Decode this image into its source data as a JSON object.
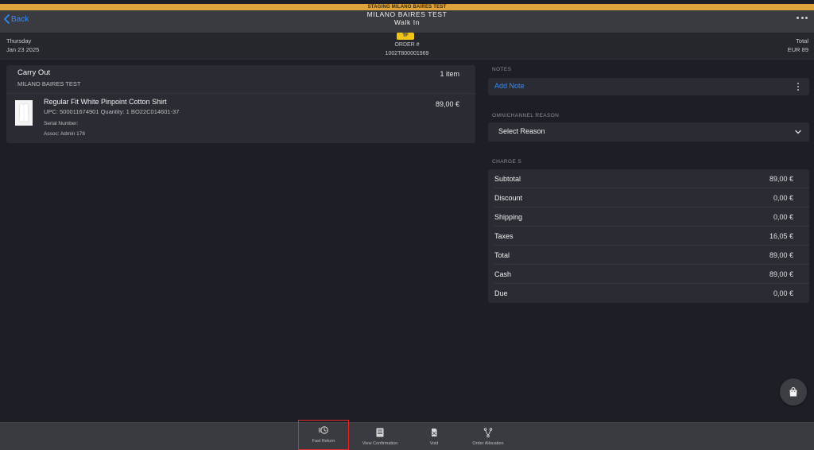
{
  "staging_banner": "STAGING MILANO BAIRES TEST",
  "header": {
    "back_label": "Back",
    "title": "MILANO BAIRES TEST",
    "subtitle": "Walk In"
  },
  "info": {
    "day": "Thursday",
    "date": "Jan 23 2025",
    "badge": "TF",
    "order_label": "ORDER #",
    "order_number": "1002T800001969",
    "total_label": "Total",
    "total_value": "EUR 89"
  },
  "order_card": {
    "fulfillment": "Carry Out",
    "store": "MILANO BAIRES TEST",
    "item_count": "1 item",
    "product": {
      "name": "Regular Fit White Pinpoint Cotton Shirt",
      "details": "UPC: 500011674901 Quantity: 1 BO22C014601-37",
      "serial": "Serial Number:",
      "assoc": "Assoc: Admin 178",
      "price": "89,00 €"
    }
  },
  "notes": {
    "section_label": "NOTES",
    "add_note": "Add Note"
  },
  "omnichannel": {
    "section_label": "OMNICHANNEL REASON",
    "select_placeholder": "Select Reason"
  },
  "charges": {
    "section_label": "CHARGE S",
    "rows": [
      {
        "label": "Subtotal",
        "value": "89,00 €"
      },
      {
        "label": "Discount",
        "value": "0,00 €"
      },
      {
        "label": "Shipping",
        "value": "0,00 €"
      },
      {
        "label": "Taxes",
        "value": "16,05 €"
      },
      {
        "label": "Total",
        "value": "89,00 €"
      },
      {
        "label": "Cash",
        "value": "89,00 €"
      },
      {
        "label": "Due",
        "value": "0,00 €"
      }
    ]
  },
  "tabs": [
    {
      "label": "Fast Return",
      "icon": "fast-return-icon"
    },
    {
      "label": "View Confirmation",
      "icon": "receipt-icon"
    },
    {
      "label": "Void",
      "icon": "void-icon"
    },
    {
      "label": "Order Allocation",
      "icon": "allocation-icon"
    }
  ],
  "colors": {
    "background": "#1e1f26",
    "accent": "#2f8cff",
    "staging": "#e0a23b",
    "badge": "#f0c419",
    "highlight": "#e02a2a"
  }
}
